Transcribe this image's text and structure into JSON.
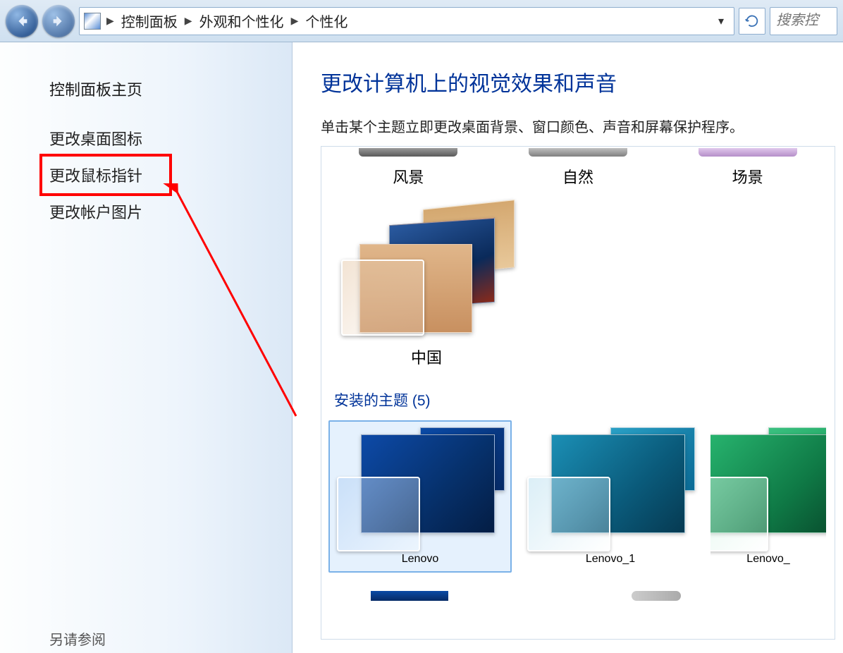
{
  "breadcrumbs": [
    "控制面板",
    "外观和个性化",
    "个性化"
  ],
  "search_placeholder": "搜索控",
  "sidebar": {
    "home": "控制面板主页",
    "links": [
      "更改桌面图标",
      "更改鼠标指针",
      "更改帐户图片"
    ],
    "see_also": "另请参阅"
  },
  "main": {
    "title": "更改计算机上的视觉效果和声音",
    "subtitle": "单击某个主题立即更改桌面背景、窗口颜色、声音和屏幕保护程序。",
    "partial_row": [
      {
        "label": "风景",
        "bar": "#6f6f6f"
      },
      {
        "label": "自然",
        "bar": "#9e9e9e"
      },
      {
        "label": "场景",
        "bar": "#c7a8d6"
      }
    ],
    "china_label": "中国",
    "installed_title": "安装的主题 (5)",
    "installed": [
      {
        "label": "Lenovo",
        "selected": true,
        "hue": "#0a4aa6"
      },
      {
        "label": "Lenovo_1",
        "selected": false,
        "hue": "#1b8fb5"
      },
      {
        "label": "Lenovo_",
        "selected": false,
        "hue": "#27b36e"
      }
    ]
  },
  "annotation": {
    "highlighted_link_index": 0
  }
}
